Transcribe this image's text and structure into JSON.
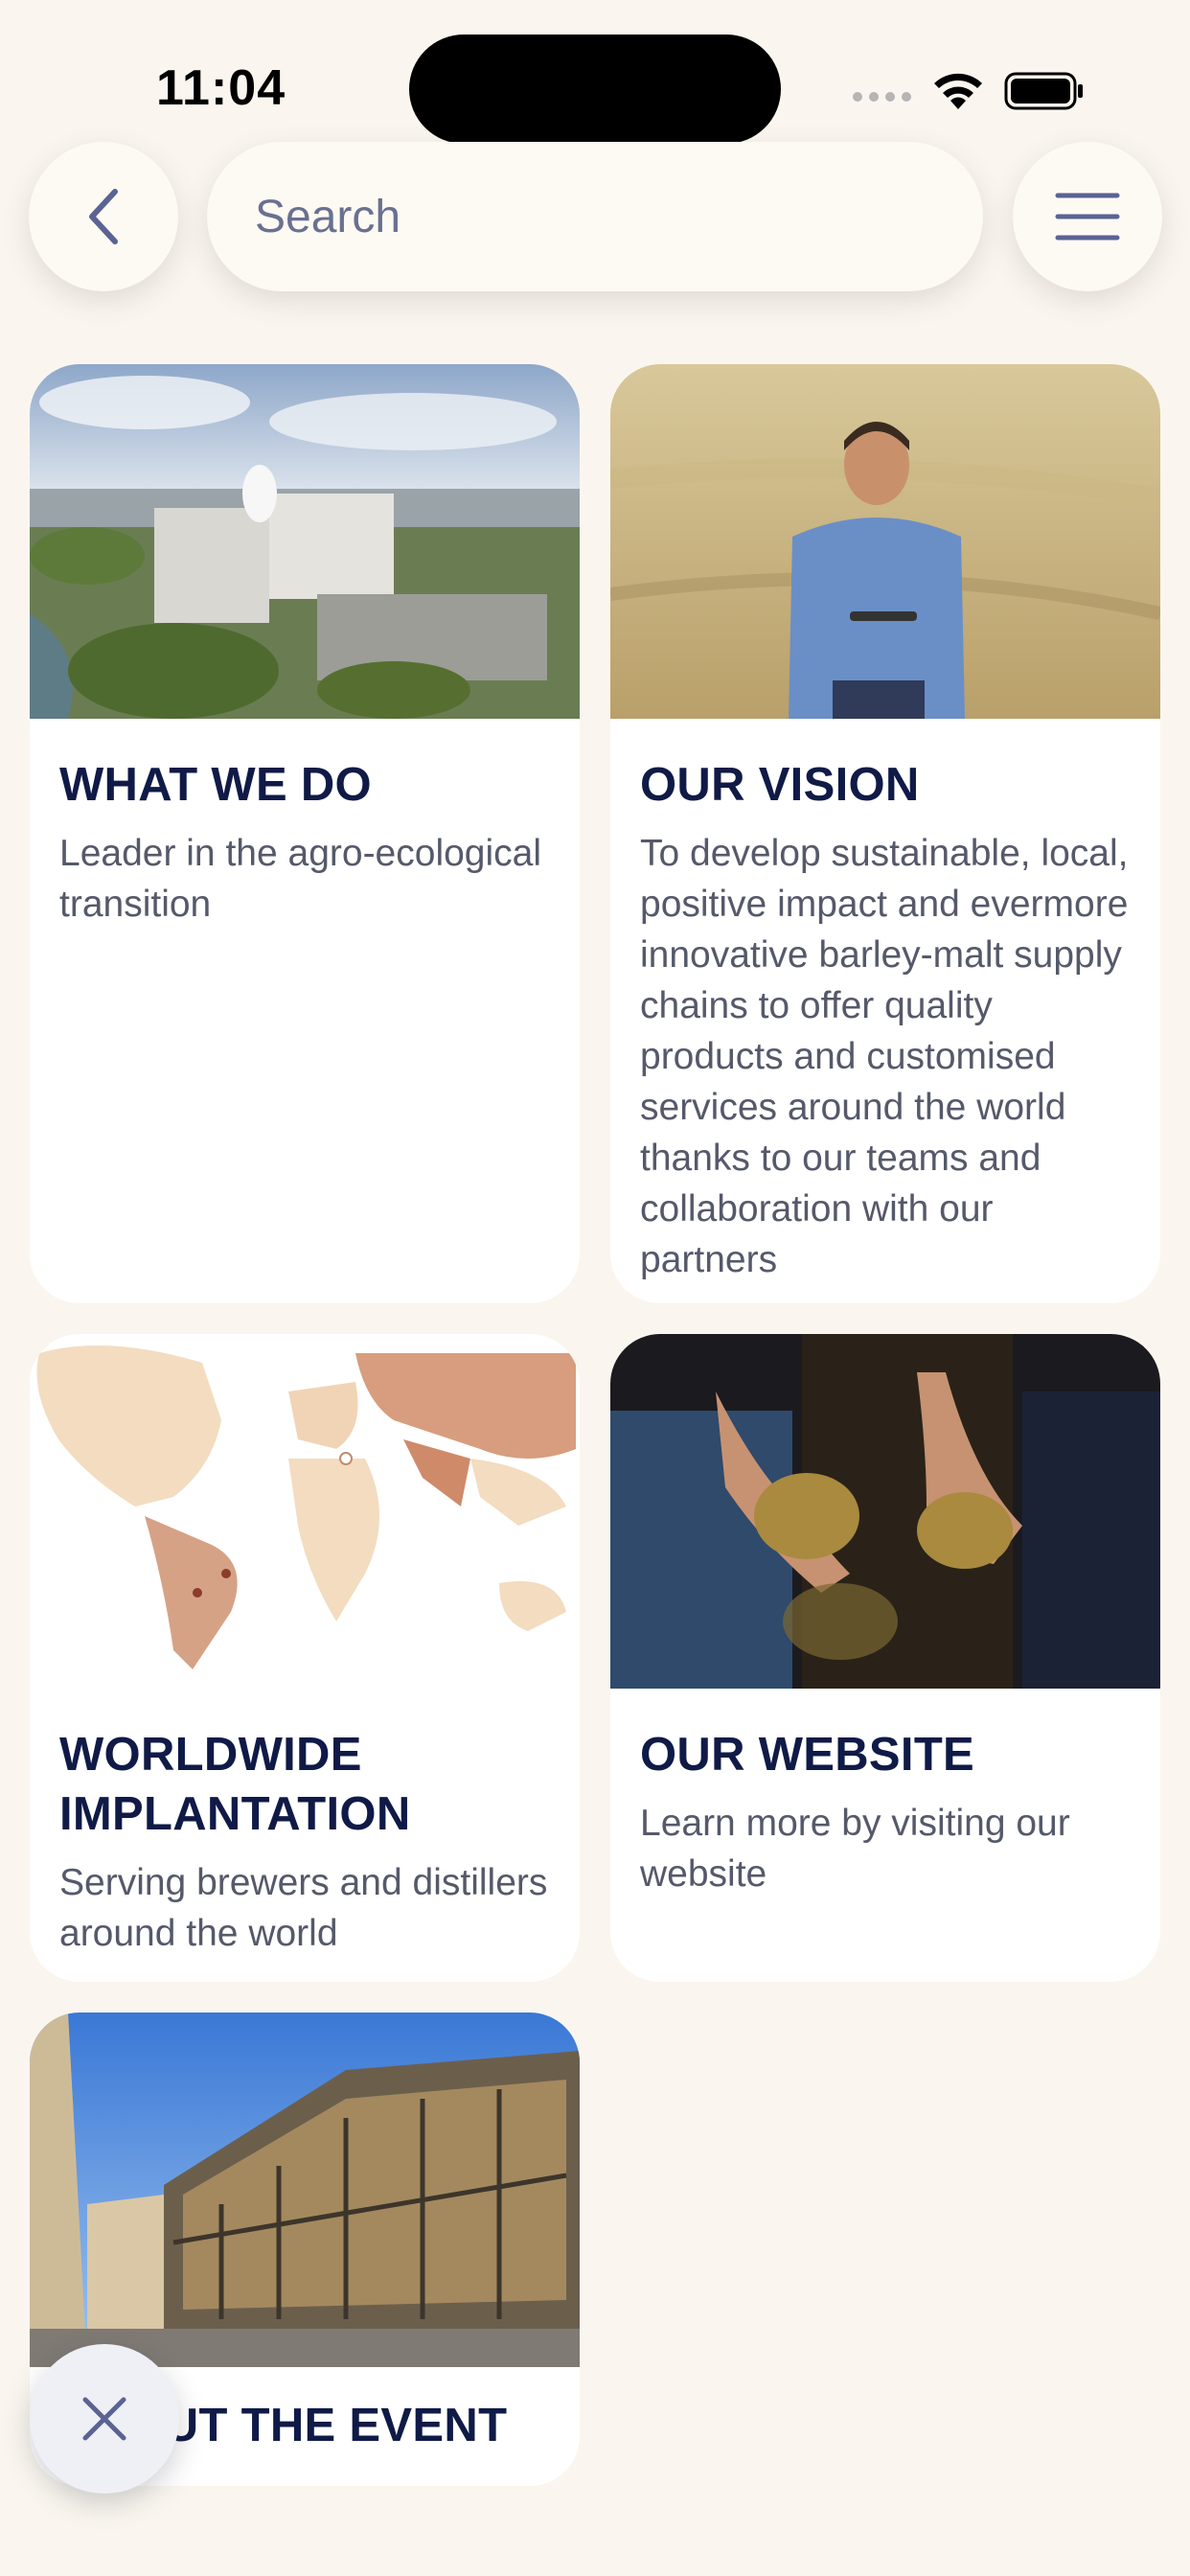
{
  "status_bar": {
    "time": "11:04"
  },
  "search": {
    "placeholder": "Search"
  },
  "icons": {
    "back": "chevron-left-icon",
    "menu": "hamburger-menu-icon",
    "close": "close-icon",
    "wifi": "wifi-icon",
    "battery": "battery-icon"
  },
  "colors": {
    "background": "#faf6ef",
    "title": "#0f1a47",
    "body_text": "#55596a",
    "accent_icon": "#5a6393"
  },
  "cards": [
    {
      "title": "WHAT WE DO",
      "text": "Leader in the agro-ecological transition"
    },
    {
      "title": "OUR VISION",
      "text": "To develop sustainable, local, positive impact and evermore innovative barley-malt supply chains to offer quality products and customised services around the world thanks to our teams and collaboration with our partners"
    },
    {
      "title": "WORLDWIDE IMPLANTATION",
      "text": "Serving brewers and distillers around the world"
    },
    {
      "title": "OUR WEBSITE",
      "text": "Learn more by visiting our website"
    },
    {
      "title": "ABOUT THE EVENT",
      "text": ""
    }
  ]
}
